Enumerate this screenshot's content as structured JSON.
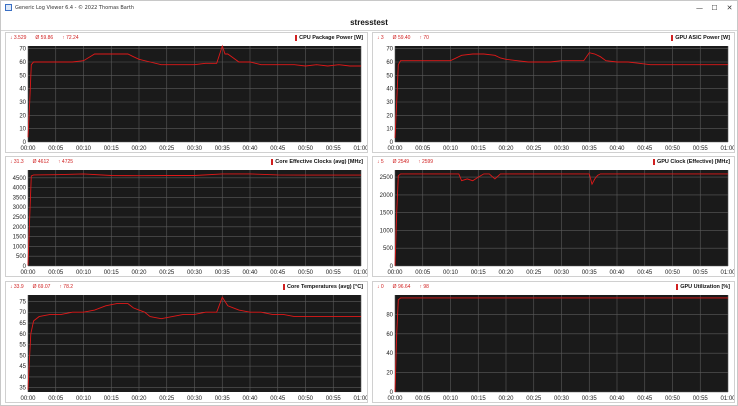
{
  "window": {
    "title": "Generic Log Viewer 6.4 - © 2022 Thomas Barth",
    "minimize": "—",
    "maximize": "☐",
    "close": "✕"
  },
  "header": {
    "title": "stresstest"
  },
  "time_ticks": [
    "00:00",
    "00:05",
    "00:10",
    "00:15",
    "00:20",
    "00:25",
    "00:30",
    "00:35",
    "00:40",
    "00:45",
    "00:50",
    "00:55",
    "01:00"
  ],
  "colors": {
    "plot_bg": "#1a1a1a",
    "grid": "#5a5a5a",
    "series": "#e01818",
    "stats": "#d02020"
  },
  "panels": [
    {
      "name": "CPU Package Power [W]",
      "min": "↓ 3.529",
      "avg": "Ø 59.86",
      "max": "↑ 72.24"
    },
    {
      "name": "GPU ASIC Power [W]",
      "min": "↓ 3",
      "avg": "Ø 59.40",
      "max": "↑ 70"
    },
    {
      "name": "Core Effective Clocks (avg) [MHz]",
      "min": "↓ 31.3",
      "avg": "Ø 4612",
      "max": "↑ 4725"
    },
    {
      "name": "GPU Clock (Effective) [MHz]",
      "min": "↓ 5",
      "avg": "Ø 2549",
      "max": "↑ 2599"
    },
    {
      "name": "Core Temperatures (avg) [°C]",
      "min": "↓ 33.9",
      "avg": "Ø 69.07",
      "max": "↑ 78.2"
    },
    {
      "name": "GPU Utilization [%]",
      "min": "↓ 0",
      "avg": "Ø 96.64",
      "max": "↑ 98"
    }
  ],
  "chart_data": [
    {
      "type": "line",
      "title": "CPU Package Power [W]",
      "yticks": [
        0,
        10,
        20,
        30,
        40,
        50,
        60,
        70
      ],
      "ylim": [
        0,
        72
      ],
      "series": [
        {
          "x": [
            0,
            0.3,
            0.6,
            1,
            2,
            4,
            6,
            8,
            10,
            12,
            14,
            16,
            18,
            19,
            20,
            22,
            24,
            26,
            28,
            30,
            32,
            34,
            35,
            35.5,
            36,
            37,
            38,
            40,
            42,
            44,
            46,
            48,
            50,
            52,
            54,
            56,
            58,
            60
          ],
          "values": [
            3.5,
            30,
            58,
            60,
            60,
            60,
            60,
            60,
            61,
            66,
            66,
            66,
            66,
            64,
            62,
            60,
            58,
            58,
            58,
            58,
            59,
            59,
            72,
            66,
            66,
            63,
            60,
            60,
            58,
            58,
            58,
            58,
            57,
            58,
            57,
            58,
            57,
            57
          ]
        }
      ]
    },
    {
      "type": "line",
      "title": "GPU ASIC Power [W]",
      "yticks": [
        0,
        10,
        20,
        30,
        40,
        50,
        60,
        70
      ],
      "ylim": [
        0,
        72
      ],
      "series": [
        {
          "x": [
            0,
            0.3,
            0.6,
            1,
            2,
            4,
            6,
            8,
            10,
            12,
            14,
            16,
            18,
            19,
            20,
            22,
            24,
            26,
            28,
            30,
            32,
            34,
            35,
            36,
            37,
            38,
            40,
            42,
            44,
            46,
            48,
            50,
            52,
            54,
            56,
            58,
            60
          ],
          "values": [
            3,
            30,
            58,
            61,
            61,
            61,
            61,
            61,
            61,
            65,
            66,
            66,
            65,
            63,
            62,
            61,
            60,
            60,
            60,
            61,
            61,
            61,
            67,
            66,
            64,
            61,
            60,
            60,
            59,
            58,
            58,
            58,
            58,
            58,
            58,
            58,
            58
          ]
        }
      ]
    },
    {
      "type": "line",
      "title": "Core Effective Clocks (avg) [MHz]",
      "yticks": [
        0,
        500,
        1000,
        1500,
        2000,
        2500,
        3000,
        3500,
        4000,
        4500
      ],
      "ylim": [
        0,
        4900
      ],
      "series": [
        {
          "x": [
            0,
            0.3,
            0.6,
            1,
            5,
            10,
            15,
            20,
            25,
            30,
            35,
            40,
            45,
            50,
            55,
            60
          ],
          "values": [
            31,
            2500,
            4600,
            4650,
            4660,
            4700,
            4620,
            4610,
            4620,
            4620,
            4700,
            4700,
            4650,
            4640,
            4640,
            4640
          ]
        }
      ]
    },
    {
      "type": "line",
      "title": "GPU Clock (Effective) [MHz]",
      "yticks": [
        0,
        500,
        1000,
        1500,
        2000,
        2500
      ],
      "ylim": [
        0,
        2700
      ],
      "series": [
        {
          "x": [
            0,
            0.3,
            0.6,
            1,
            5,
            10,
            11.5,
            12,
            13,
            14,
            15,
            16,
            17,
            18,
            19,
            20,
            25,
            30,
            35,
            35.5,
            36,
            36.5,
            37,
            40,
            45,
            50,
            55,
            60
          ],
          "values": [
            5,
            1500,
            2540,
            2590,
            2590,
            2590,
            2590,
            2400,
            2450,
            2400,
            2500,
            2590,
            2590,
            2450,
            2590,
            2590,
            2590,
            2590,
            2590,
            2300,
            2450,
            2550,
            2590,
            2590,
            2590,
            2590,
            2590,
            2590
          ]
        }
      ]
    },
    {
      "type": "line",
      "title": "Core Temperatures (avg) [°C]",
      "yticks": [
        35,
        40,
        45,
        50,
        55,
        60,
        65,
        70,
        75
      ],
      "ylim": [
        33,
        78
      ],
      "series": [
        {
          "x": [
            0,
            0.2,
            0.5,
            1,
            2,
            4,
            6,
            8,
            10,
            12,
            14,
            16,
            18,
            19,
            20,
            21,
            22,
            24,
            26,
            28,
            30,
            32,
            34,
            35,
            36,
            37,
            38,
            40,
            42,
            44,
            46,
            48,
            50,
            52,
            54,
            56,
            58,
            60
          ],
          "values": [
            34,
            45,
            60,
            66,
            68,
            69,
            69,
            70,
            70,
            71,
            73,
            74,
            74,
            72,
            71,
            70,
            68,
            67,
            68,
            69,
            69,
            70,
            70,
            77,
            73,
            72,
            71,
            70,
            70,
            69,
            69,
            68,
            68,
            68,
            68,
            68,
            68,
            68
          ]
        }
      ]
    },
    {
      "type": "line",
      "title": "GPU Utilization [%]",
      "yticks": [
        0,
        20,
        40,
        60,
        80
      ],
      "ylim": [
        0,
        100
      ],
      "series": [
        {
          "x": [
            0,
            0.3,
            0.6,
            1,
            5,
            10,
            15,
            20,
            25,
            30,
            35,
            40,
            45,
            50,
            55,
            60
          ],
          "values": [
            0,
            60,
            95,
            97,
            97,
            97,
            97,
            97,
            97,
            97,
            97,
            97,
            97,
            97,
            97,
            97
          ]
        }
      ]
    }
  ]
}
